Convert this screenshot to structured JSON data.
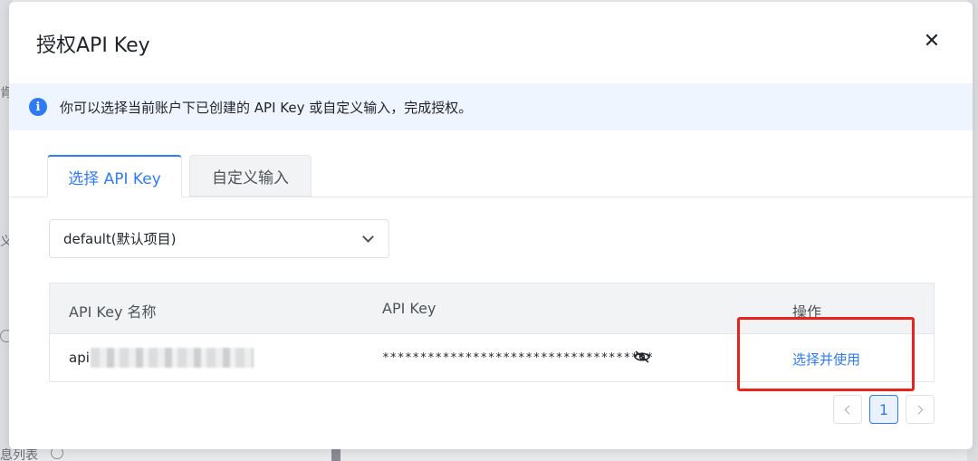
{
  "background": {
    "fragments": [
      "肯",
      "义",
      "息列表"
    ]
  },
  "dialog": {
    "title": "授权API Key",
    "close_glyph": "✕",
    "info": {
      "icon_glyph": "i",
      "text": "你可以选择当前账户下已创建的 API Key 或自定义输入，完成授权。"
    },
    "tabs": [
      {
        "label": "选择 API Key",
        "active": true
      },
      {
        "label": "自定义输入",
        "active": false
      }
    ],
    "project_select": {
      "value": "default(默认项目)"
    },
    "table": {
      "columns": [
        "API Key 名称",
        "API Key",
        "操作"
      ],
      "rows": [
        {
          "name_visible": "api",
          "key_masked": "************************************",
          "action": "选择并使用"
        }
      ]
    },
    "pagination": {
      "current_page": "1"
    }
  },
  "colors": {
    "primary": "#2f7bf5",
    "highlight": "#e8231c",
    "info_bg": "#eef5fe"
  }
}
